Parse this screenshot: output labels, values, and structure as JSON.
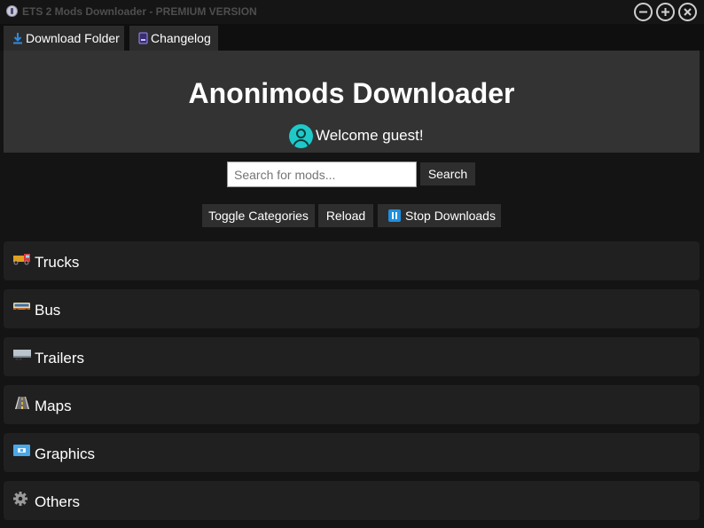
{
  "window": {
    "title": "ETS 2 Mods Downloader - PREMIUM VERSION"
  },
  "tabs": [
    {
      "label": "Download Folder",
      "icon": "download-icon"
    },
    {
      "label": "Changelog",
      "icon": "document-icon"
    }
  ],
  "header": {
    "title": "Anonimods Downloader",
    "welcome": "Welcome guest!"
  },
  "search": {
    "placeholder": "Search for mods...",
    "value": "",
    "button": "Search"
  },
  "actions": {
    "toggle": "Toggle Categories",
    "reload": "Reload",
    "stop": "Stop Downloads"
  },
  "categories": [
    {
      "label": "Trucks",
      "icon": "truck-icon"
    },
    {
      "label": "Bus",
      "icon": "bus-icon"
    },
    {
      "label": "Trailers",
      "icon": "trailer-icon"
    },
    {
      "label": "Maps",
      "icon": "road-icon"
    },
    {
      "label": "Graphics",
      "icon": "4k-screen-icon"
    },
    {
      "label": "Others",
      "icon": "gear-icon"
    }
  ],
  "colors": {
    "background": "#141414",
    "header": "#333333",
    "category": "#202020",
    "button": "#2e2e2e",
    "avatar": "#1fc9c9",
    "accent_blue": "#1e8fe0"
  }
}
